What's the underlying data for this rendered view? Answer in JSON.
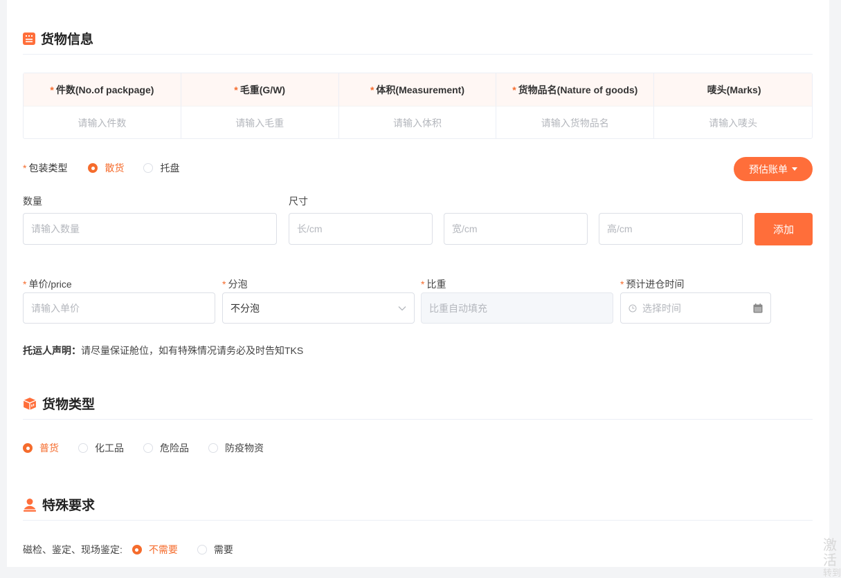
{
  "sections": {
    "cargo_info": "货物信息",
    "cargo_type": "货物类型",
    "special": "特殊要求"
  },
  "goods_table": {
    "headers": [
      {
        "label": "件数(No.of packpage)",
        "required": "*"
      },
      {
        "label": "毛重(G/W)",
        "required": "*"
      },
      {
        "label": "体积(Measurement)",
        "required": "*"
      },
      {
        "label": "货物品名(Nature of goods)",
        "required": "*"
      },
      {
        "label": "唛头(Marks)",
        "required": ""
      }
    ],
    "placeholders": [
      "请输入件数",
      "请输入毛重",
      "请输入体积",
      "请输入货物品名",
      "请输入唛头"
    ]
  },
  "packaging": {
    "required": "*",
    "label": "包装类型",
    "options": [
      "散货",
      "托盘"
    ],
    "selected": "散货",
    "estimate_button": "预估账单"
  },
  "quantity": {
    "label": "数量",
    "placeholder": "请输入数量"
  },
  "size": {
    "label": "尺寸",
    "length_placeholder": "长/cm",
    "width_placeholder": "宽/cm",
    "height_placeholder": "高/cm",
    "add_button": "添加"
  },
  "pricing": {
    "unit_price": {
      "required": "*",
      "label": "单价/price",
      "placeholder": "请输入单价"
    },
    "split": {
      "required": "*",
      "label": "分泡",
      "value": "不分泡"
    },
    "ratio": {
      "required": "*",
      "label": "比重",
      "placeholder": "比重自动填充"
    },
    "arrival": {
      "required": "*",
      "label": "预计进仓时间",
      "placeholder": "选择时间"
    }
  },
  "declaration": {
    "label": "托运人声明：",
    "text": "请尽量保证舱位，如有特殊情况请务必及时告知TKS"
  },
  "cargo_types": {
    "options": [
      "普货",
      "化工品",
      "危险品",
      "防疫物资"
    ],
    "selected": "普货"
  },
  "inspection": {
    "label": "磁检、鉴定、现场鉴定:",
    "options": [
      "不需要",
      "需要"
    ],
    "selected": "不需要"
  },
  "watermark": {
    "line1": "激活",
    "line2": "转到"
  },
  "colors": {
    "accent": "#ff6e3a",
    "header_bg": "#fff7f4"
  }
}
